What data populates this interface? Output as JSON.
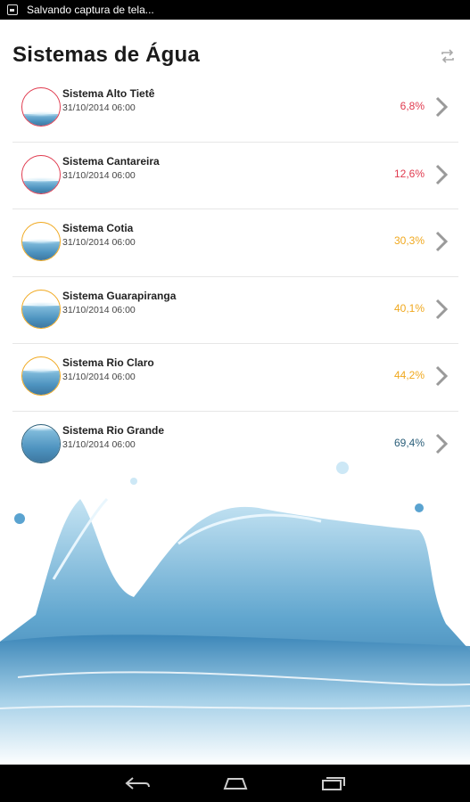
{
  "status_bar": {
    "notification_text": "Salvando captura de tela..."
  },
  "header": {
    "title": "Sistemas de Água"
  },
  "systems": [
    {
      "name": "Sistema Alto Tietê",
      "date": "31/10/2014 06:00",
      "percent": "6,8%",
      "level": 0.068,
      "color": "#e03a4e"
    },
    {
      "name": "Sistema Cantareira",
      "date": "31/10/2014 06:00",
      "percent": "12,6%",
      "level": 0.126,
      "color": "#e03a4e"
    },
    {
      "name": "Sistema Cotia",
      "date": "31/10/2014 06:00",
      "percent": "30,3%",
      "level": 0.303,
      "color": "#f0a81e"
    },
    {
      "name": "Sistema Guarapiranga",
      "date": "31/10/2014 06:00",
      "percent": "40,1%",
      "level": 0.401,
      "color": "#f0a81e"
    },
    {
      "name": "Sistema Rio Claro",
      "date": "31/10/2014 06:00",
      "percent": "44,2%",
      "level": 0.442,
      "color": "#f0a81e"
    },
    {
      "name": "Sistema Rio Grande",
      "date": "31/10/2014 06:00",
      "percent": "69,4%",
      "level": 0.694,
      "color": "#2b5f7a"
    }
  ],
  "icons": {
    "refresh": "refresh-icon",
    "chevron": "chevron-right-icon",
    "back": "back-icon",
    "home": "home-icon",
    "recents": "recents-icon"
  },
  "colors": {
    "chevron": "#9a9a9a",
    "divider": "#e6e6e6",
    "water": "#2d7fb3"
  }
}
